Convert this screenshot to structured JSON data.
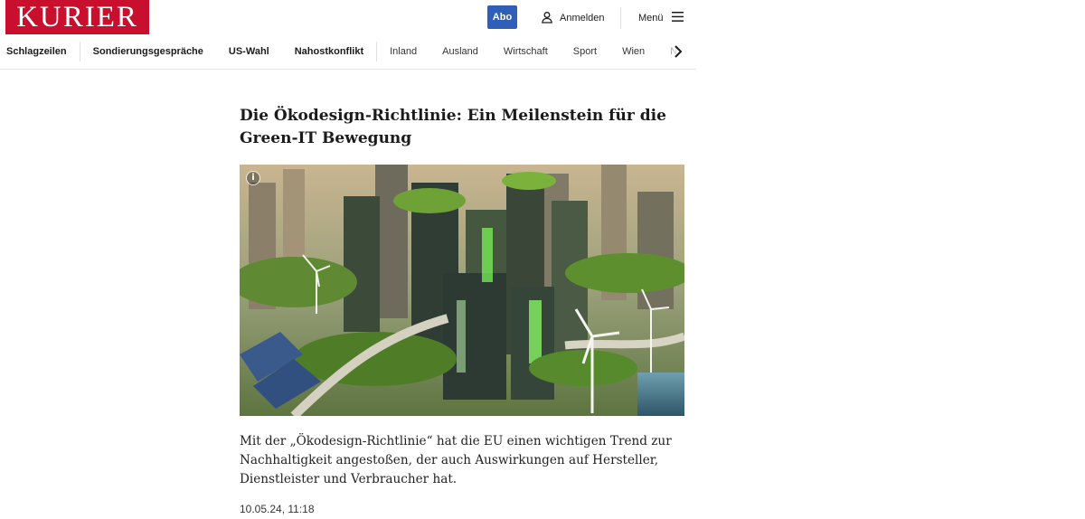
{
  "header": {
    "logo_text": "KURIER",
    "abo_label": "Abo",
    "login_label": "Anmelden",
    "menu_label": "Menü",
    "brand_color": "#c8102e",
    "abo_color": "#2f5fb8"
  },
  "nav": {
    "items": [
      {
        "label": "Schlagzeilen"
      },
      {
        "label": "Sondierungsgespräche"
      },
      {
        "label": "US-Wahl"
      },
      {
        "label": "Nahostkonflikt"
      },
      {
        "label": "Inland"
      },
      {
        "label": "Ausland"
      },
      {
        "label": "Wirtschaft"
      },
      {
        "label": "Sport"
      },
      {
        "label": "Wien"
      },
      {
        "label": "N"
      }
    ],
    "more_icon": "chevron-right-icon"
  },
  "article": {
    "headline": "Die Ökodesign-Richtlinie: Ein Meilenstein für die Green-IT Bewegung",
    "image_info_icon": "info-icon",
    "lead": "Mit der „Ökodesign-Richtlinie“ hat die EU einen wichtigen Trend zur Nachhaltigkeit angestoßen, der auch Auswirkungen auf Hersteller, Dienstleister und Verbraucher hat.",
    "date": "10.05.24, 11:18"
  }
}
